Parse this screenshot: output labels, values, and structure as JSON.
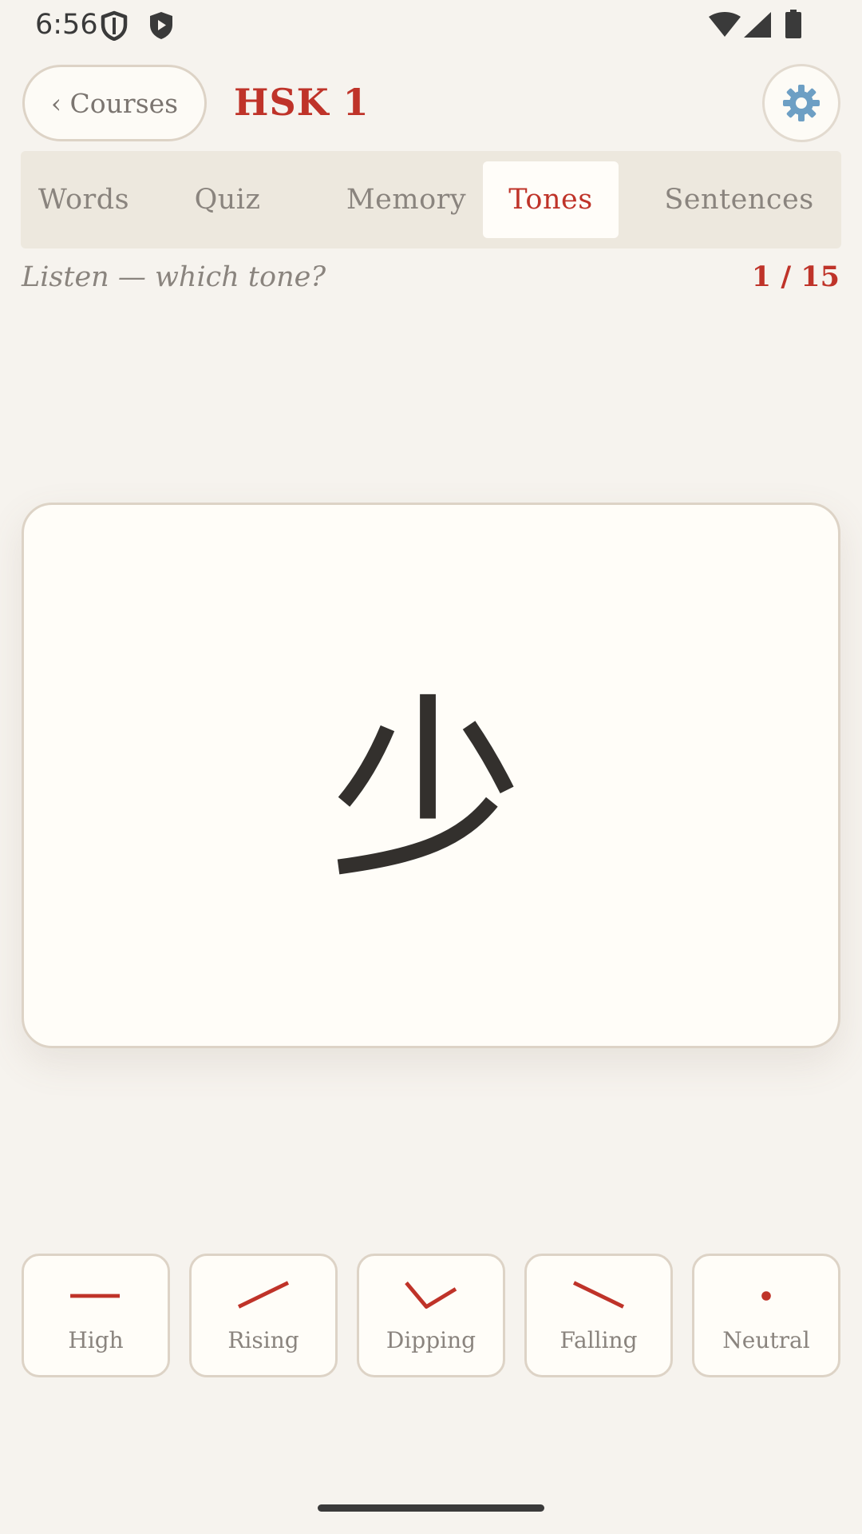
{
  "status_bar": {
    "time": "6:56",
    "icons": [
      "shield-outline-icon",
      "play-shield-icon",
      "wifi-icon",
      "cell-signal-icon",
      "battery-icon"
    ]
  },
  "header": {
    "back_label": "‹ Courses",
    "title": "HSK 1",
    "settings_icon": "gear-icon"
  },
  "tabs": [
    {
      "label": "Words",
      "active": false
    },
    {
      "label": "Quiz",
      "active": false
    },
    {
      "label": "Memory",
      "active": false
    },
    {
      "label": "Tones",
      "active": true
    },
    {
      "label": "Sentences",
      "active": false
    }
  ],
  "prompt": {
    "text": "Listen — which tone?",
    "progress": "1 / 15"
  },
  "card": {
    "character": "少"
  },
  "tones": [
    {
      "label": "High",
      "icon": "high-tone-icon"
    },
    {
      "label": "Rising",
      "icon": "rising-tone-icon"
    },
    {
      "label": "Dipping",
      "icon": "dipping-tone-icon"
    },
    {
      "label": "Falling",
      "icon": "falling-tone-icon"
    },
    {
      "label": "Neutral",
      "icon": "neutral-tone-icon"
    }
  ],
  "colors": {
    "accent": "#bf3329",
    "background": "#f6f3ee",
    "card": "#fffdf8",
    "border": "#ddd3c6",
    "muted_text": "#8a847e",
    "character": "#33302d"
  }
}
